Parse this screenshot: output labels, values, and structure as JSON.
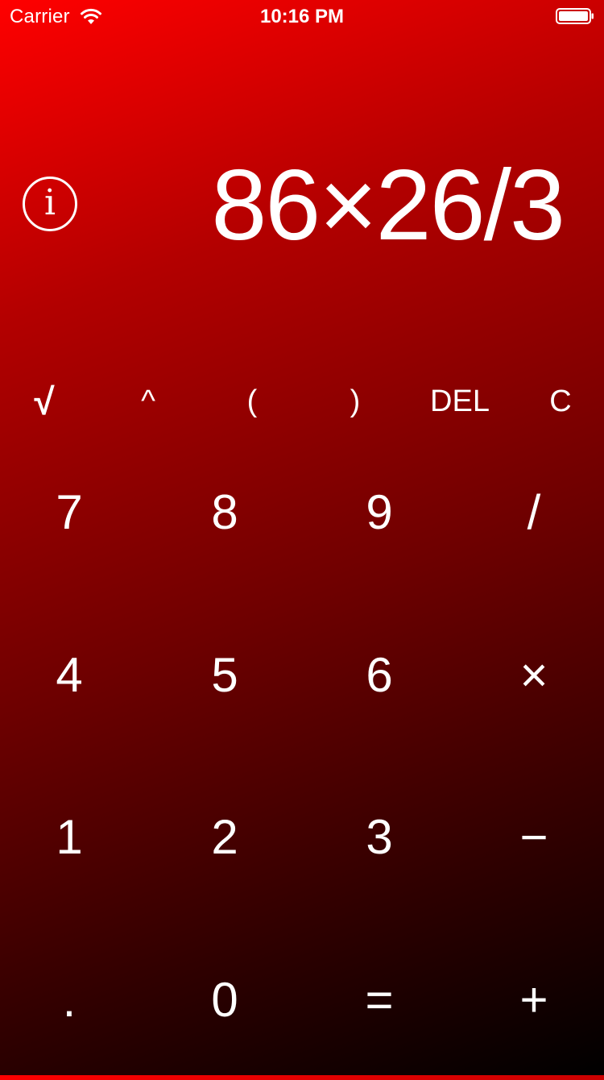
{
  "status_bar": {
    "carrier": "Carrier",
    "time": "10:16 PM"
  },
  "info_button": {
    "glyph": "i",
    "icon": "info-icon"
  },
  "display": {
    "expression": "86×26/3"
  },
  "function_row": [
    {
      "label": "√",
      "name": "sqrt-button"
    },
    {
      "label": "^",
      "name": "power-button"
    },
    {
      "label": "(",
      "name": "open-paren-button"
    },
    {
      "label": ")",
      "name": "close-paren-button"
    },
    {
      "label": "DEL",
      "name": "delete-button"
    },
    {
      "label": "C",
      "name": "clear-button"
    }
  ],
  "keypad": [
    [
      {
        "label": "7",
        "name": "digit-7-button"
      },
      {
        "label": "8",
        "name": "digit-8-button"
      },
      {
        "label": "9",
        "name": "digit-9-button"
      },
      {
        "label": "/",
        "name": "divide-button"
      }
    ],
    [
      {
        "label": "4",
        "name": "digit-4-button"
      },
      {
        "label": "5",
        "name": "digit-5-button"
      },
      {
        "label": "6",
        "name": "digit-6-button"
      },
      {
        "label": "×",
        "name": "multiply-button"
      }
    ],
    [
      {
        "label": "1",
        "name": "digit-1-button"
      },
      {
        "label": "2",
        "name": "digit-2-button"
      },
      {
        "label": "3",
        "name": "digit-3-button"
      },
      {
        "label": "−",
        "name": "subtract-button"
      }
    ],
    [
      {
        "label": ".",
        "name": "decimal-button"
      },
      {
        "label": "0",
        "name": "digit-0-button"
      },
      {
        "label": "=",
        "name": "equals-button"
      },
      {
        "label": "+",
        "name": "add-button"
      }
    ]
  ],
  "colors": {
    "gradient_start": "#ff0000",
    "gradient_end": "#000000",
    "text": "#ffffff"
  }
}
